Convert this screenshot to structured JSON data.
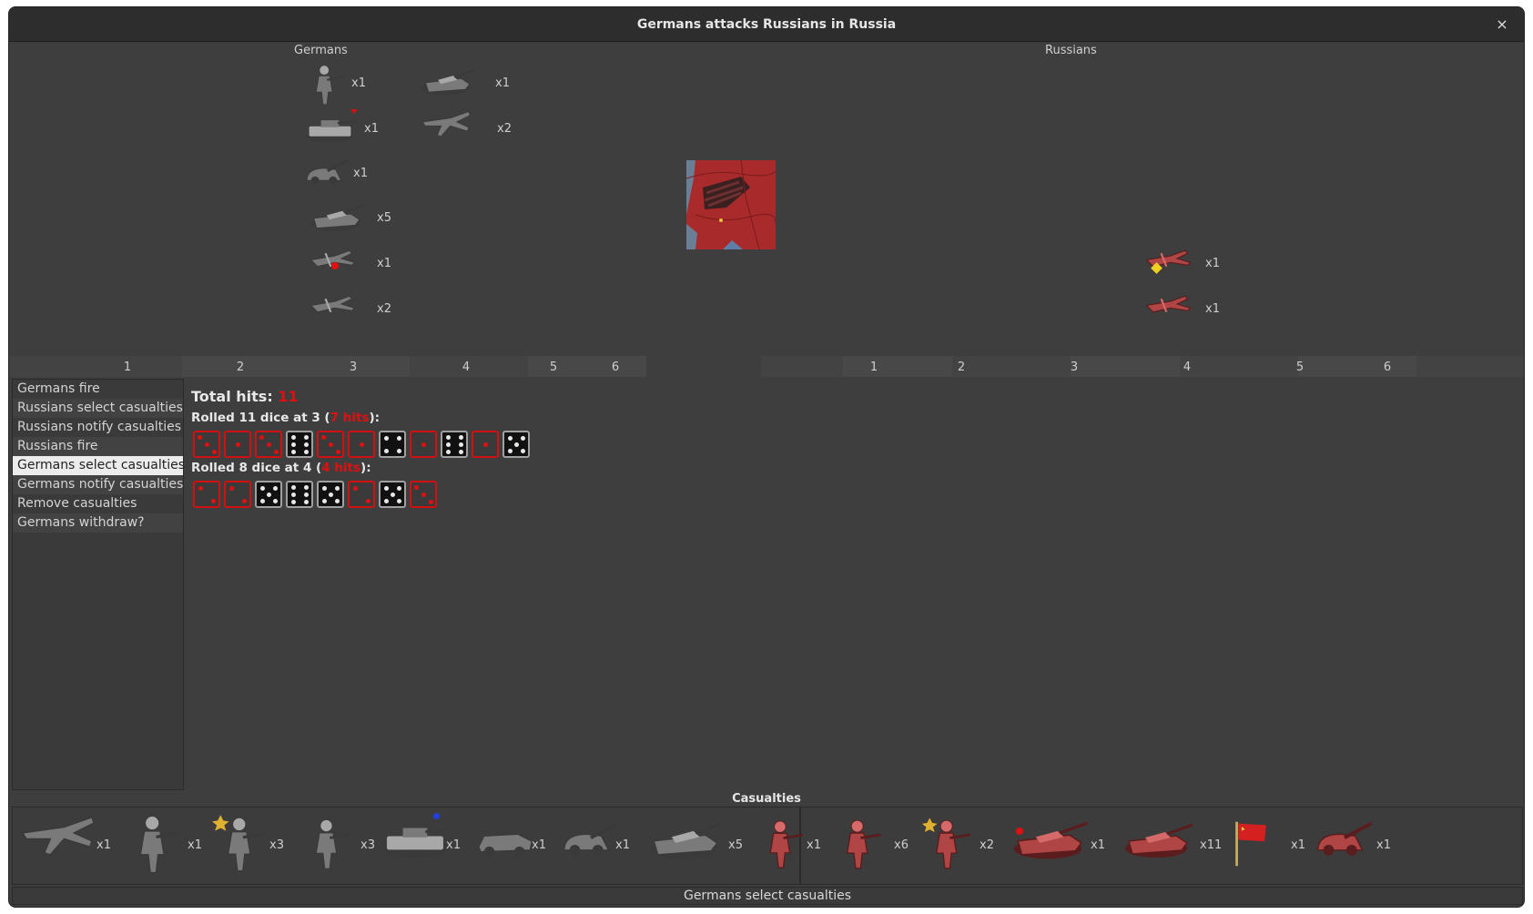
{
  "window": {
    "title": "Germans attacks Russians in Russia",
    "close_label": "×"
  },
  "attacker": {
    "name": "Germans"
  },
  "defender": {
    "name": "Russians"
  },
  "german_units": [
    {
      "icon": "infantry-icon",
      "count": "x1"
    },
    {
      "icon": "tiger-tank-icon",
      "count": "x1"
    },
    {
      "icon": "artillery-icon",
      "count": "x1"
    },
    {
      "icon": "tank-icon",
      "count": "x5"
    },
    {
      "icon": "fighter-icon",
      "count": "x1"
    },
    {
      "icon": "fighter-icon",
      "count": "x2"
    },
    {
      "icon": "tank-destroyer-icon",
      "count": "x1"
    },
    {
      "icon": "bomber-icon",
      "count": "x2"
    }
  ],
  "russian_units": [
    {
      "icon": "fighter-icon",
      "count": "x1"
    },
    {
      "icon": "fighter-icon",
      "count": "x1"
    }
  ],
  "columns_left": [
    "1",
    "2",
    "3",
    "4",
    "5",
    "6"
  ],
  "columns_right": [
    "1",
    "2",
    "3",
    "4",
    "5",
    "6"
  ],
  "steps": [
    "Germans fire",
    "Russians select casualties",
    "Russians notify casualties",
    "Russians fire",
    "Germans select casualties",
    "Germans notify casualties",
    "Remove casualties",
    "Germans withdraw?"
  ],
  "selected_step": 4,
  "roll": {
    "total_label": "Total hits: ",
    "total_value": "11",
    "groups": [
      {
        "prefix": "Rolled 11 dice at 3 (",
        "hits": "7 hits",
        "suffix": "):",
        "dice": [
          3,
          1,
          3,
          6,
          3,
          1,
          4,
          1,
          6,
          1,
          5
        ],
        "hit": [
          true,
          true,
          true,
          false,
          true,
          true,
          false,
          true,
          false,
          true,
          false
        ]
      },
      {
        "prefix": "Rolled 8 dice at 4 (",
        "hits": "4 hits",
        "suffix": "):",
        "dice": [
          2,
          2,
          5,
          6,
          5,
          2,
          5,
          3
        ],
        "hit": [
          true,
          true,
          false,
          false,
          false,
          true,
          false,
          true
        ]
      }
    ]
  },
  "casualties": {
    "title": "Casualties",
    "german": [
      {
        "icon": "bomber-icon",
        "count": "x1"
      },
      {
        "icon": "elite-infantry-icon",
        "count": "x1"
      },
      {
        "icon": "marine-icon",
        "count": "x3"
      },
      {
        "icon": "infantry-icon",
        "count": "x3"
      },
      {
        "icon": "tiger-tank-icon",
        "count": "x1"
      },
      {
        "icon": "armored-car-icon",
        "count": "x1"
      },
      {
        "icon": "artillery-icon",
        "count": "x1"
      },
      {
        "icon": "tank-icon",
        "count": "x5"
      }
    ],
    "russian": [
      {
        "icon": "infantry-icon",
        "count": "x1"
      },
      {
        "icon": "elite-infantry-icon",
        "count": "x6"
      },
      {
        "icon": "officer-icon",
        "count": "x2"
      },
      {
        "icon": "heavy-tank-icon",
        "count": "x1"
      },
      {
        "icon": "tank-icon",
        "count": "x11"
      },
      {
        "icon": "flag-icon",
        "count": "x1"
      },
      {
        "icon": "aa-gun-icon",
        "count": "x1"
      }
    ]
  },
  "status": "Germans select  casualties",
  "colors": {
    "german_unit": "#7a7a7a",
    "russian_unit": "#b04545",
    "hit_border": "#d21010",
    "territory": "#a82a2a"
  }
}
